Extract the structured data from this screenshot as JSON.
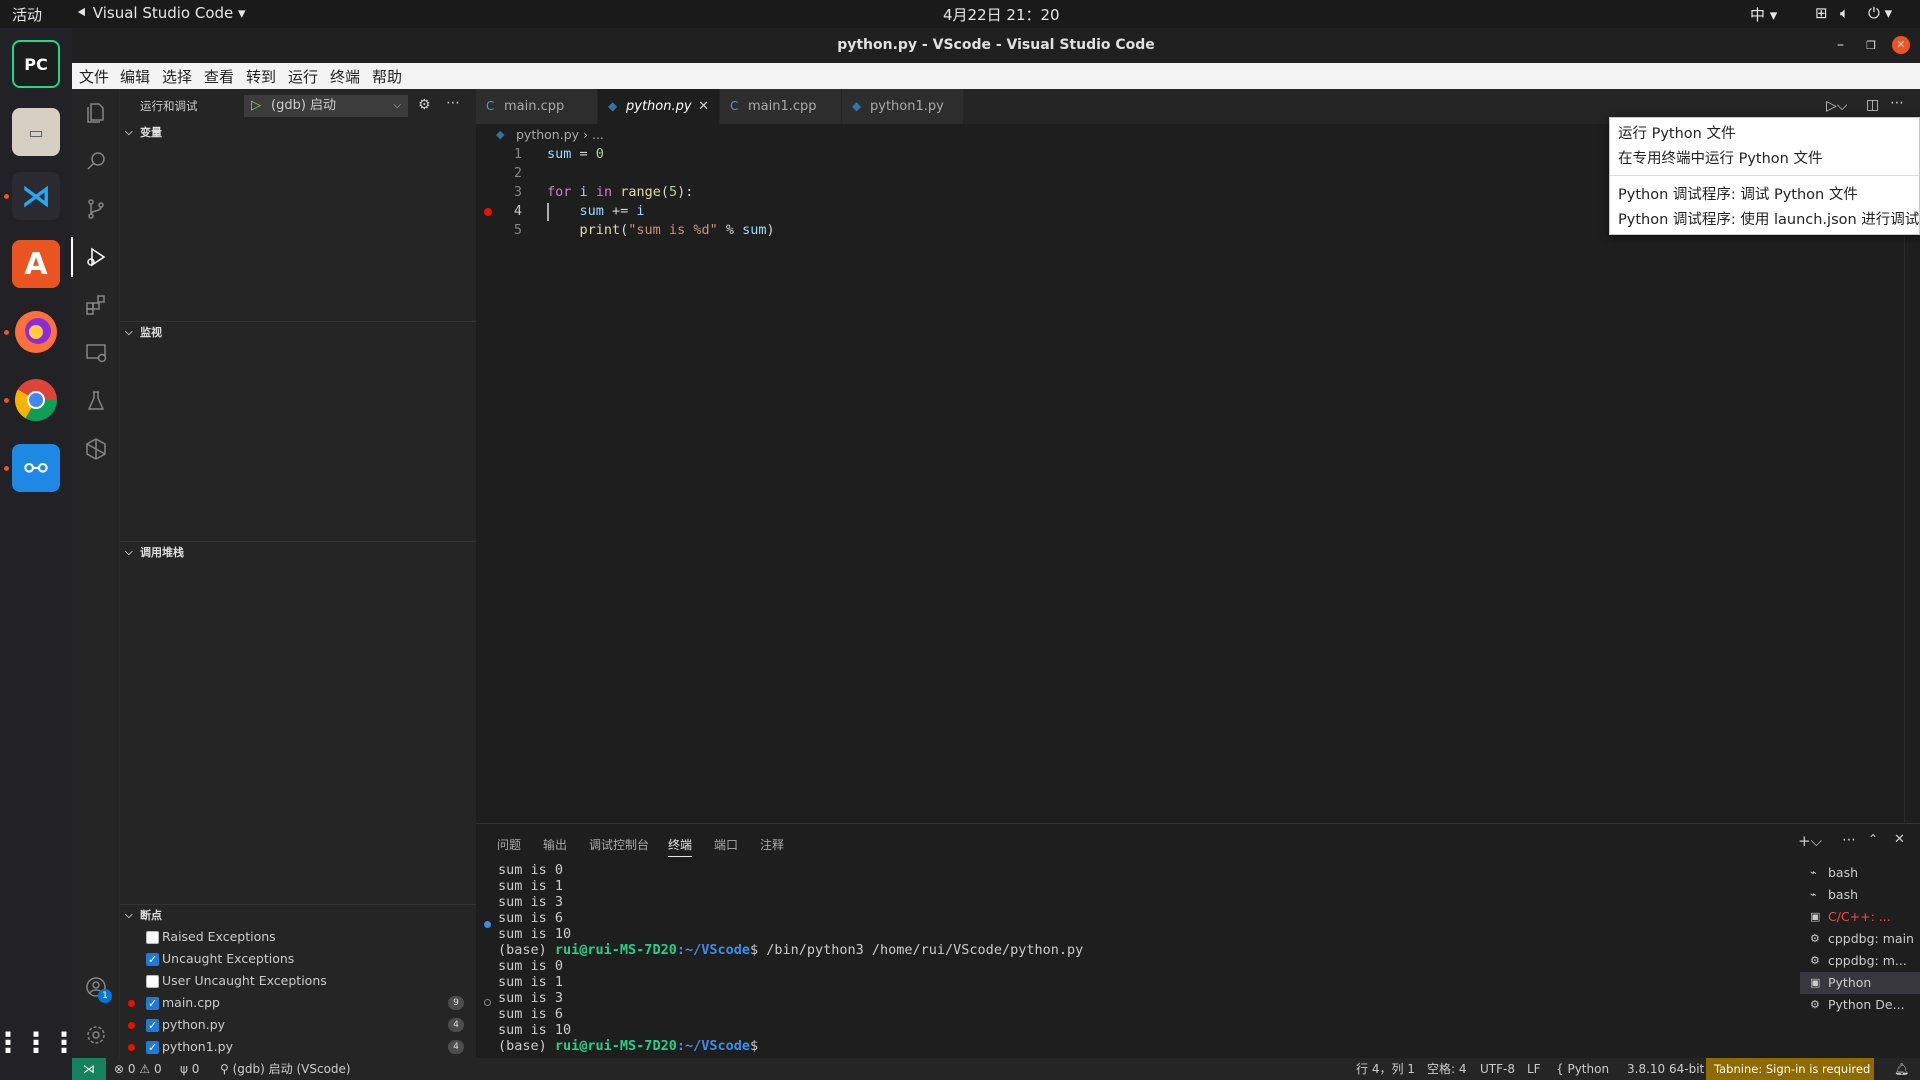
{
  "system": {
    "activities": "活动",
    "app_name": "Visual Studio Code",
    "clock": "4月22日  21：20",
    "input_method": "中"
  },
  "window": {
    "title": "python.py - VScode - Visual Studio Code"
  },
  "menu": [
    "文件",
    "编辑",
    "选择",
    "查看",
    "转到",
    "运行",
    "终端",
    "帮助"
  ],
  "debug": {
    "header": "运行和调试",
    "config": "(gdb) 启动",
    "sections": {
      "variables": "变量",
      "watch": "监视",
      "callstack": "调用堆栈",
      "breakpoints": "断点"
    },
    "breakpoints": [
      {
        "label": "Raised Exceptions",
        "checked": false,
        "dot": false,
        "count": ""
      },
      {
        "label": "Uncaught Exceptions",
        "checked": true,
        "dot": false,
        "count": ""
      },
      {
        "label": "User Uncaught Exceptions",
        "checked": false,
        "dot": false,
        "count": ""
      },
      {
        "label": "main.cpp",
        "checked": true,
        "dot": true,
        "count": "9"
      },
      {
        "label": "python.py",
        "checked": true,
        "dot": true,
        "count": "4"
      },
      {
        "label": "python1.py",
        "checked": true,
        "dot": true,
        "count": "4"
      }
    ]
  },
  "tabs": [
    {
      "label": "main.cpp",
      "icon": "C",
      "active": false
    },
    {
      "label": "python.py",
      "icon": "◆",
      "active": true
    },
    {
      "label": "main1.cpp",
      "icon": "C",
      "active": false
    },
    {
      "label": "python1.py",
      "icon": "◆",
      "active": false
    }
  ],
  "breadcrumb": {
    "file": "python.py",
    "rest": "› ..."
  },
  "code_lines": [
    "1",
    "2",
    "3",
    "4",
    "5"
  ],
  "run_menu": {
    "item1": "运行 Python 文件",
    "item2": "在专用终端中运行 Python 文件",
    "item3": "Python 调试程序: 调试 Python 文件",
    "item4": "Python 调试程序: 使用 launch.json 进行调试"
  },
  "panel_tabs": [
    "问题",
    "输出",
    "调试控制台",
    "终端",
    "端口",
    "注释"
  ],
  "terminal": {
    "out1": [
      "sum is 0",
      "sum is 1",
      "sum is 3",
      "sum is 6",
      "sum is 10"
    ],
    "prompt_base": "(base) ",
    "prompt_user": "rui@rui-MS-7D20",
    "prompt_path": ":~/VScode",
    "command": "$ /bin/python3 /home/rui/VScode/python.py",
    "out2": [
      "sum is 0",
      "sum is 1",
      "sum is 3",
      "sum is 6",
      "sum is 10"
    ],
    "prompt_end": "$"
  },
  "terminal_list": [
    {
      "label": "bash",
      "icon": "bash"
    },
    {
      "label": "bash",
      "icon": "bash"
    },
    {
      "label": "C/C++: ...",
      "icon": "term"
    },
    {
      "label": "cppdbg: main",
      "icon": "gear"
    },
    {
      "label": "cppdbg: m...",
      "icon": "gear"
    },
    {
      "label": "Python",
      "icon": "term"
    },
    {
      "label": "Python De...",
      "icon": "gear"
    }
  ],
  "status": {
    "errors": "0",
    "warnings": "0",
    "ports": "0",
    "debug": "(gdb) 启动 (VScode)",
    "position": "行 4，列 1",
    "spaces": "空格: 4",
    "encoding": "UTF-8",
    "eol": "LF",
    "language": "Python",
    "interpreter": "3.8.10 64-bit",
    "tabnine": "Tabnine: Sign-in is required"
  },
  "accounts_badge": "1"
}
